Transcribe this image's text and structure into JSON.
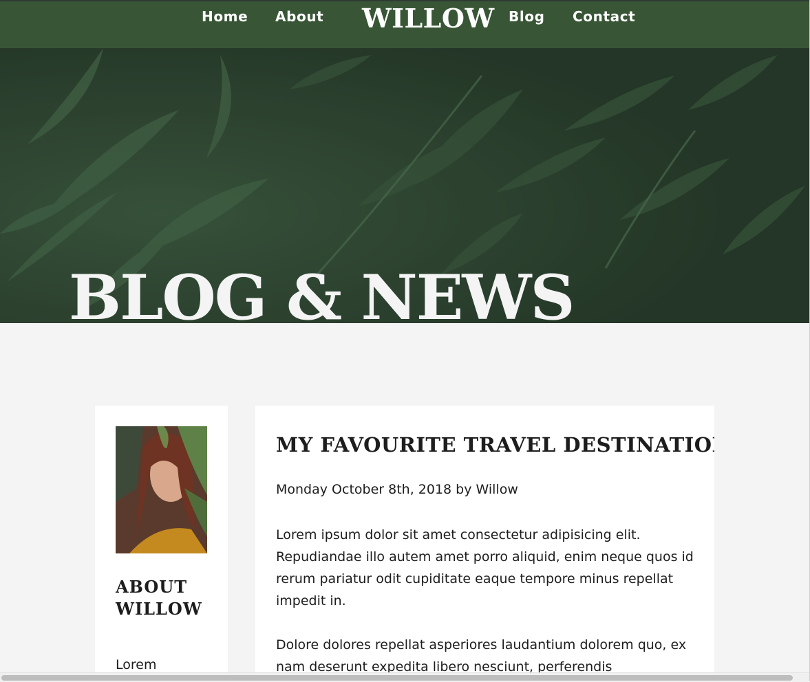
{
  "nav": {
    "links_left": [
      "Home",
      "About"
    ],
    "brand": "WILLOW",
    "links_right": [
      "Blog",
      "Contact"
    ]
  },
  "hero": {
    "title": "BLOG & NEWS"
  },
  "sidebar": {
    "heading": "ABOUT WILLOW",
    "text": "Lorem"
  },
  "post": {
    "title": "MY FAVOURITE TRAVEL DESTINATION",
    "meta": "Monday October 8th, 2018 by Willow",
    "paragraphs": [
      "Lorem ipsum dolor sit amet consectetur adipisicing elit. Repudiandae illo autem amet porro aliquid, enim neque quos id rerum pariatur odit cupiditate eaque tempore minus repellat impedit in.",
      "Dolore dolores repellat asperiores laudantium dolorem quo, ex nam deserunt expedita libero nesciunt, perferendis"
    ]
  },
  "colors": {
    "nav_bg": "#385636",
    "hero_bg": "#2a3f2c",
    "page_bg": "#f4f4f4",
    "card_bg": "#ffffff"
  }
}
